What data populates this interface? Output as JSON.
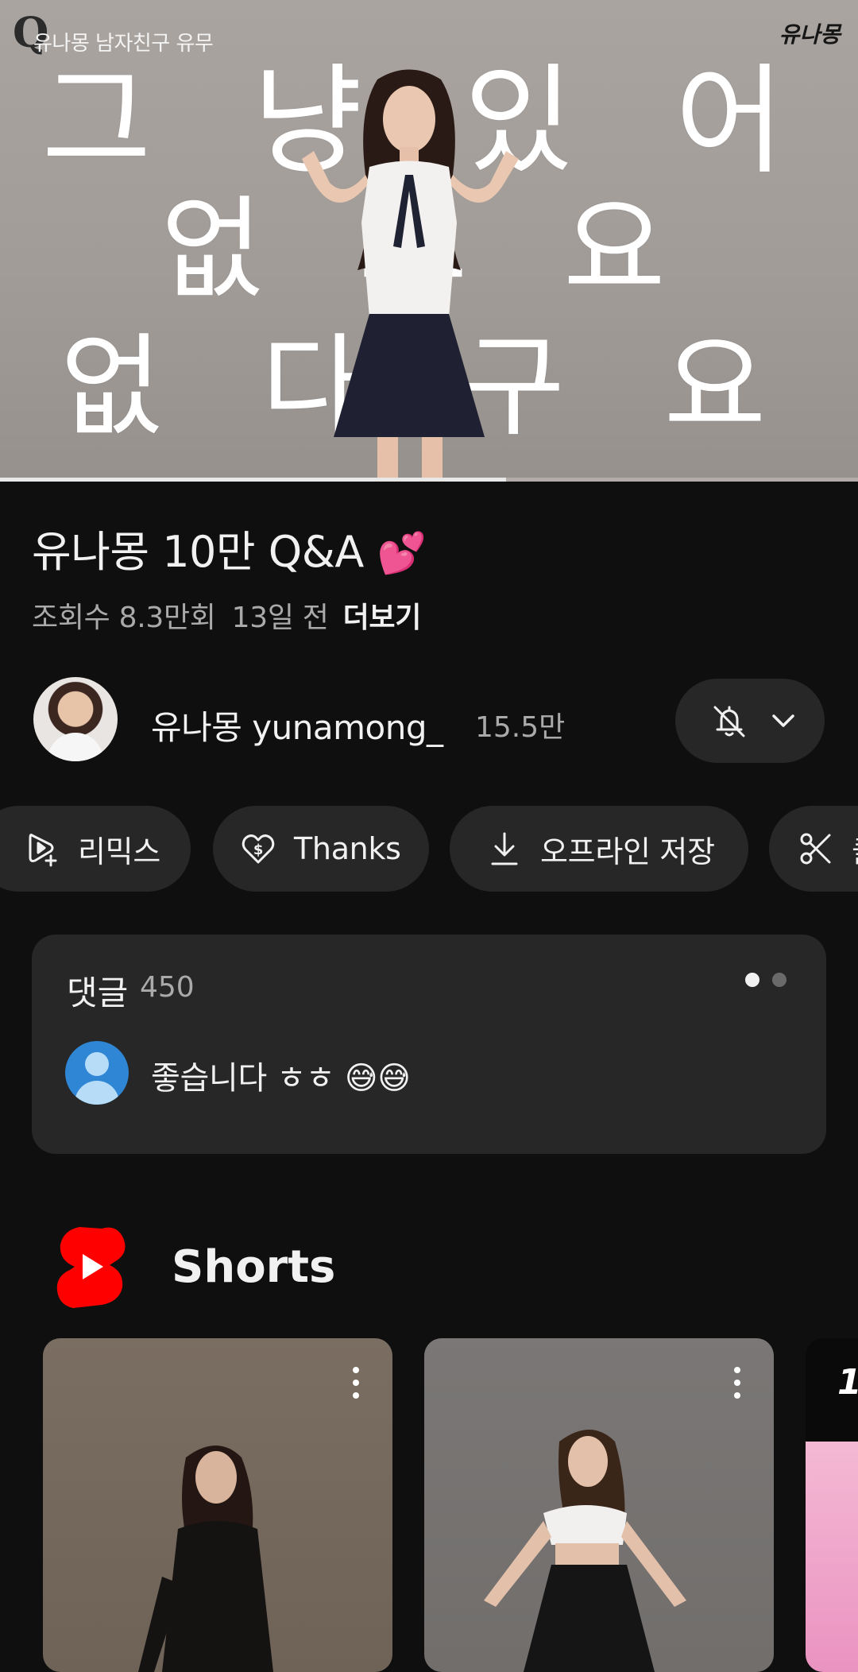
{
  "player": {
    "channel_logo": "Q",
    "overlay_title": "유나몽 남자친구 유무",
    "signature": "유나몽",
    "caption_line1": "그 냥 있 어 요",
    "caption_line2": "없 어 요",
    "caption_line3": "없 다 구 요",
    "progress": 0.59
  },
  "video": {
    "title": "유나몽 10만 Q&A",
    "title_emoji": "💕",
    "views": "조회수 8.3만회",
    "age": "13일 전",
    "more_label": "더보기"
  },
  "channel": {
    "name": "유나몽 yunamong_",
    "subscribers": "15.5만"
  },
  "actions": [
    {
      "label": "리믹스",
      "icon": "remix-icon"
    },
    {
      "label": "Thanks",
      "icon": "thanks-heart-icon"
    },
    {
      "label": "오프라인 저장",
      "icon": "download-icon"
    },
    {
      "label": "클립",
      "icon": "scissors-icon"
    }
  ],
  "comments": {
    "label": "댓글",
    "count": "450",
    "top_comment": "좋습니다 ㅎㅎ 😅😅"
  },
  "shorts": {
    "title": "Shorts",
    "third_badge": "1"
  },
  "colors": {
    "background": "#0f0f0f",
    "chip": "#272727",
    "secondary_text": "#aaaaaa",
    "shorts_red": "#ff0000"
  }
}
